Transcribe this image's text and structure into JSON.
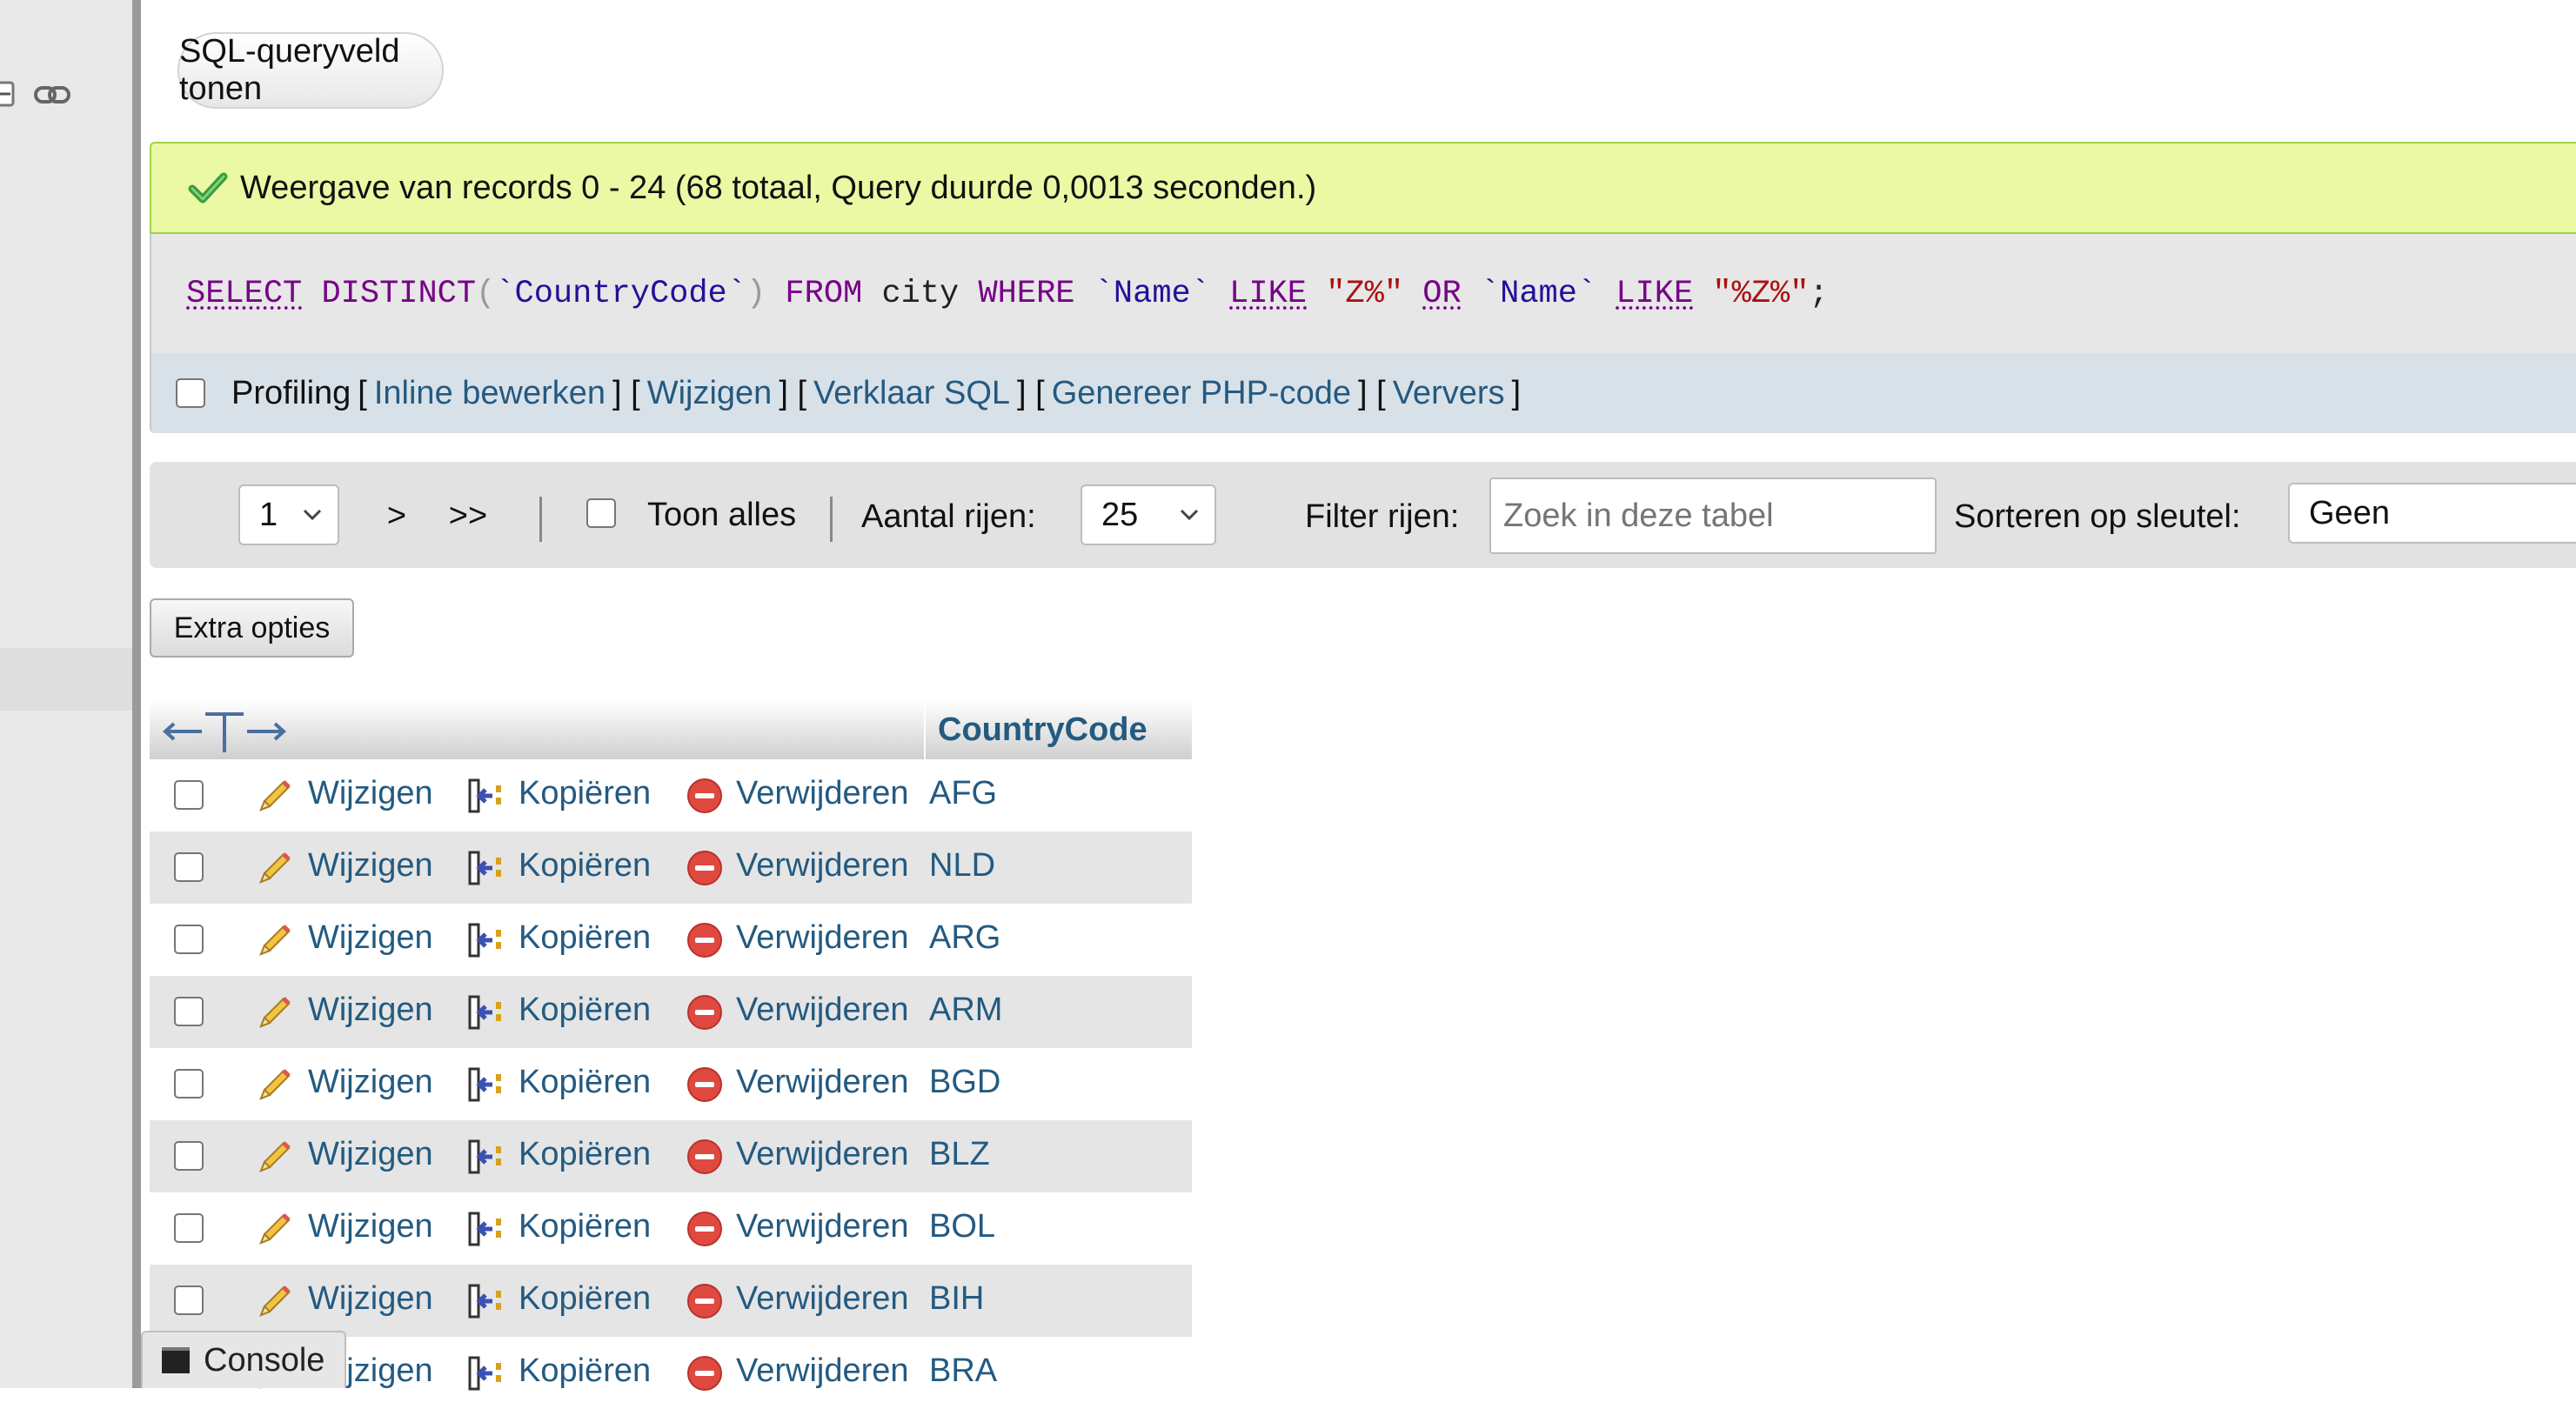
{
  "toggle_query_button": "SQL-queryveld tonen",
  "success_message": "Weergave van records 0 - 24 (68 totaal, Query duurde 0,0013 seconden.)",
  "sql": {
    "t1": "SELECT",
    "t2": " ",
    "t3": "DISTINCT",
    "t4": "(",
    "t5": "`CountryCode`",
    "t6": ")",
    "t7": " ",
    "t8": "FROM",
    "t9": " city ",
    "t10": "WHERE",
    "t11": " ",
    "t12": "`Name`",
    "t13": " ",
    "t14": "LIKE",
    "t15": " ",
    "t16": "\"Z%\"",
    "t17": " ",
    "t18": "OR",
    "t19": " ",
    "t20": "`Name`",
    "t21": " ",
    "t22": "LIKE",
    "t23": " ",
    "t24": "\"%Z%\"",
    "t25": ";"
  },
  "profiling": {
    "label": "Profiling",
    "open": "[",
    "sep": "] [",
    "close": "]",
    "links": [
      "Inline bewerken",
      "Wijzigen",
      "Verklaar SQL",
      "Genereer PHP-code",
      "Ververs"
    ]
  },
  "nav": {
    "page_value": "1",
    "next": ">",
    "last": ">>",
    "show_all": "Toon alles",
    "rows_label": "Aantal rijen:",
    "rows_value": "25",
    "filter_label": "Filter rijen:",
    "filter_placeholder": "Zoek in deze tabel",
    "sort_label": "Sorteren op sleutel:",
    "sort_value": "Geen"
  },
  "extra_options": "Extra opties",
  "table": {
    "column": "CountryCode",
    "actions": {
      "edit": "Wijzigen",
      "copy": "Kopiëren",
      "delete": "Verwijderen"
    },
    "rows": [
      "AFG",
      "NLD",
      "ARG",
      "ARM",
      "BGD",
      "BLZ",
      "BOL",
      "BIH",
      "BRA"
    ]
  },
  "console": "Console",
  "colors": {
    "link": "#235a81",
    "success_bg": "#ebf8a4",
    "keyword": "#770088",
    "string": "#aa1111"
  },
  "icons": [
    "link-icon",
    "check-icon",
    "chevron-down-icon",
    "column-arrows-icon",
    "pencil-icon",
    "copy-icon",
    "delete-icon",
    "console-icon"
  ]
}
